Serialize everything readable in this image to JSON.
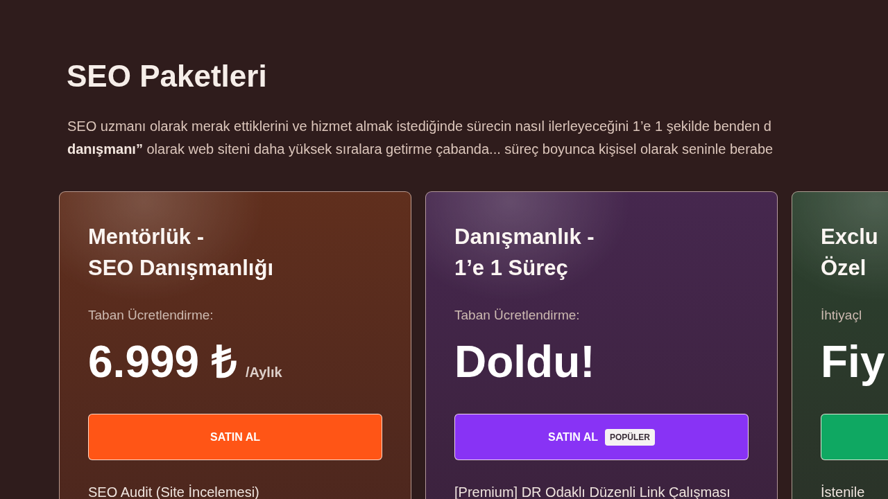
{
  "page": {
    "title": "SEO Paketleri",
    "intro_lines": [
      "SEO uzmanı olarak merak ettiklerini ve hizmet almak istediğinde sürecin nasıl ilerleyeceğini 1’e 1 şekilde benden d",
      "**danışmanı”** olarak web siteni daha yüksek sıralara getirme çabanda... süreç boyunca kişisel olarak seninle berabe"
    ]
  },
  "plans": [
    {
      "title_lines": [
        "Mentörlük -",
        "SEO Danışmanlığı"
      ],
      "price_label": "Taban Ücretlendirme:",
      "price": "6.999 ₺",
      "period": "/Aylık",
      "button": {
        "label": "SATIN AL",
        "color": "#ff5516"
      },
      "features": [
        "SEO Audit (Site İncelemesi)"
      ]
    },
    {
      "title_lines": [
        "Danışmanlık -",
        "1’e 1 Süreç"
      ],
      "price_label": "Taban Ücretlendirme:",
      "price": "Doldu!",
      "button": {
        "label": "SATIN AL",
        "badge": "POPÜLER",
        "color": "#8833f5"
      },
      "features": [
        "[Premium] DR Odaklı Düzenli Link Çalışması"
      ]
    },
    {
      "title_lines": [
        "Exclu",
        "Özel"
      ],
      "price_label": "İhtiyaçl",
      "price": "Fiy",
      "button": {
        "color": "#0fa862"
      },
      "features": [
        "İstenile"
      ]
    }
  ]
}
